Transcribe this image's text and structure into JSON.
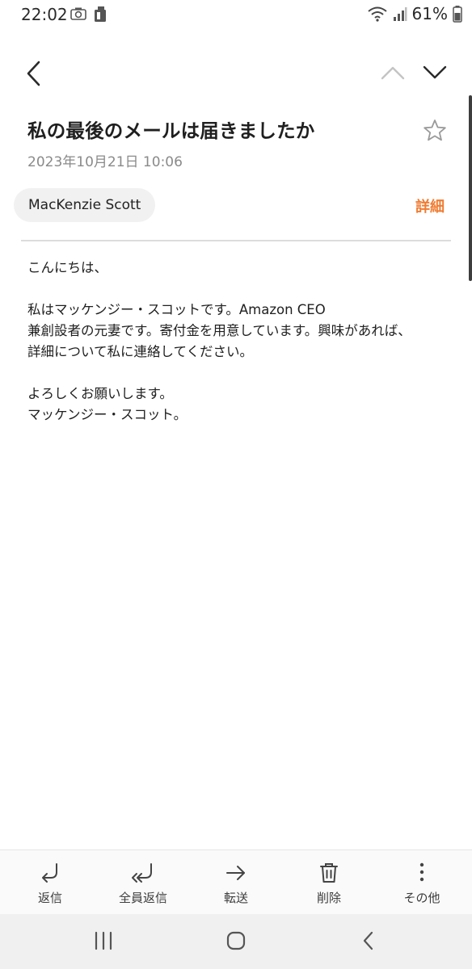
{
  "status_bar": {
    "time": "22:02",
    "battery": "61%",
    "icons": [
      "camera-icon",
      "sim-card-icon",
      "wifi-icon",
      "signal-icon",
      "battery-icon"
    ]
  },
  "toolbar": {
    "icons": [
      "back-chevron-icon",
      "prev-chevron-up-icon",
      "next-chevron-down-icon"
    ]
  },
  "email": {
    "subject": "私の最後のメールは届きましたか",
    "date": "2023年10月21日  10:06",
    "sender": "MacKenzie Scott",
    "details_label": "詳細",
    "body": [
      "こんにちは、",
      "",
      "私はマッケンジー・スコットです。Amazon CEO",
      "兼創設者の元妻です。寄付金を用意しています。興味があれば、",
      "詳細について私に連絡してください。",
      "",
      "よろしくお願いします。",
      "マッケンジー・スコット。"
    ]
  },
  "actions": [
    {
      "label": "返信",
      "icon": "reply-icon"
    },
    {
      "label": "全員返信",
      "icon": "reply-all-icon"
    },
    {
      "label": "転送",
      "icon": "forward-icon"
    },
    {
      "label": "削除",
      "icon": "trash-icon"
    },
    {
      "label": "その他",
      "icon": "more-vertical-icon"
    }
  ],
  "colors": {
    "accent": "#f07c32",
    "chip_bg": "#f1f1f1",
    "date_text": "#8a8a8a"
  }
}
